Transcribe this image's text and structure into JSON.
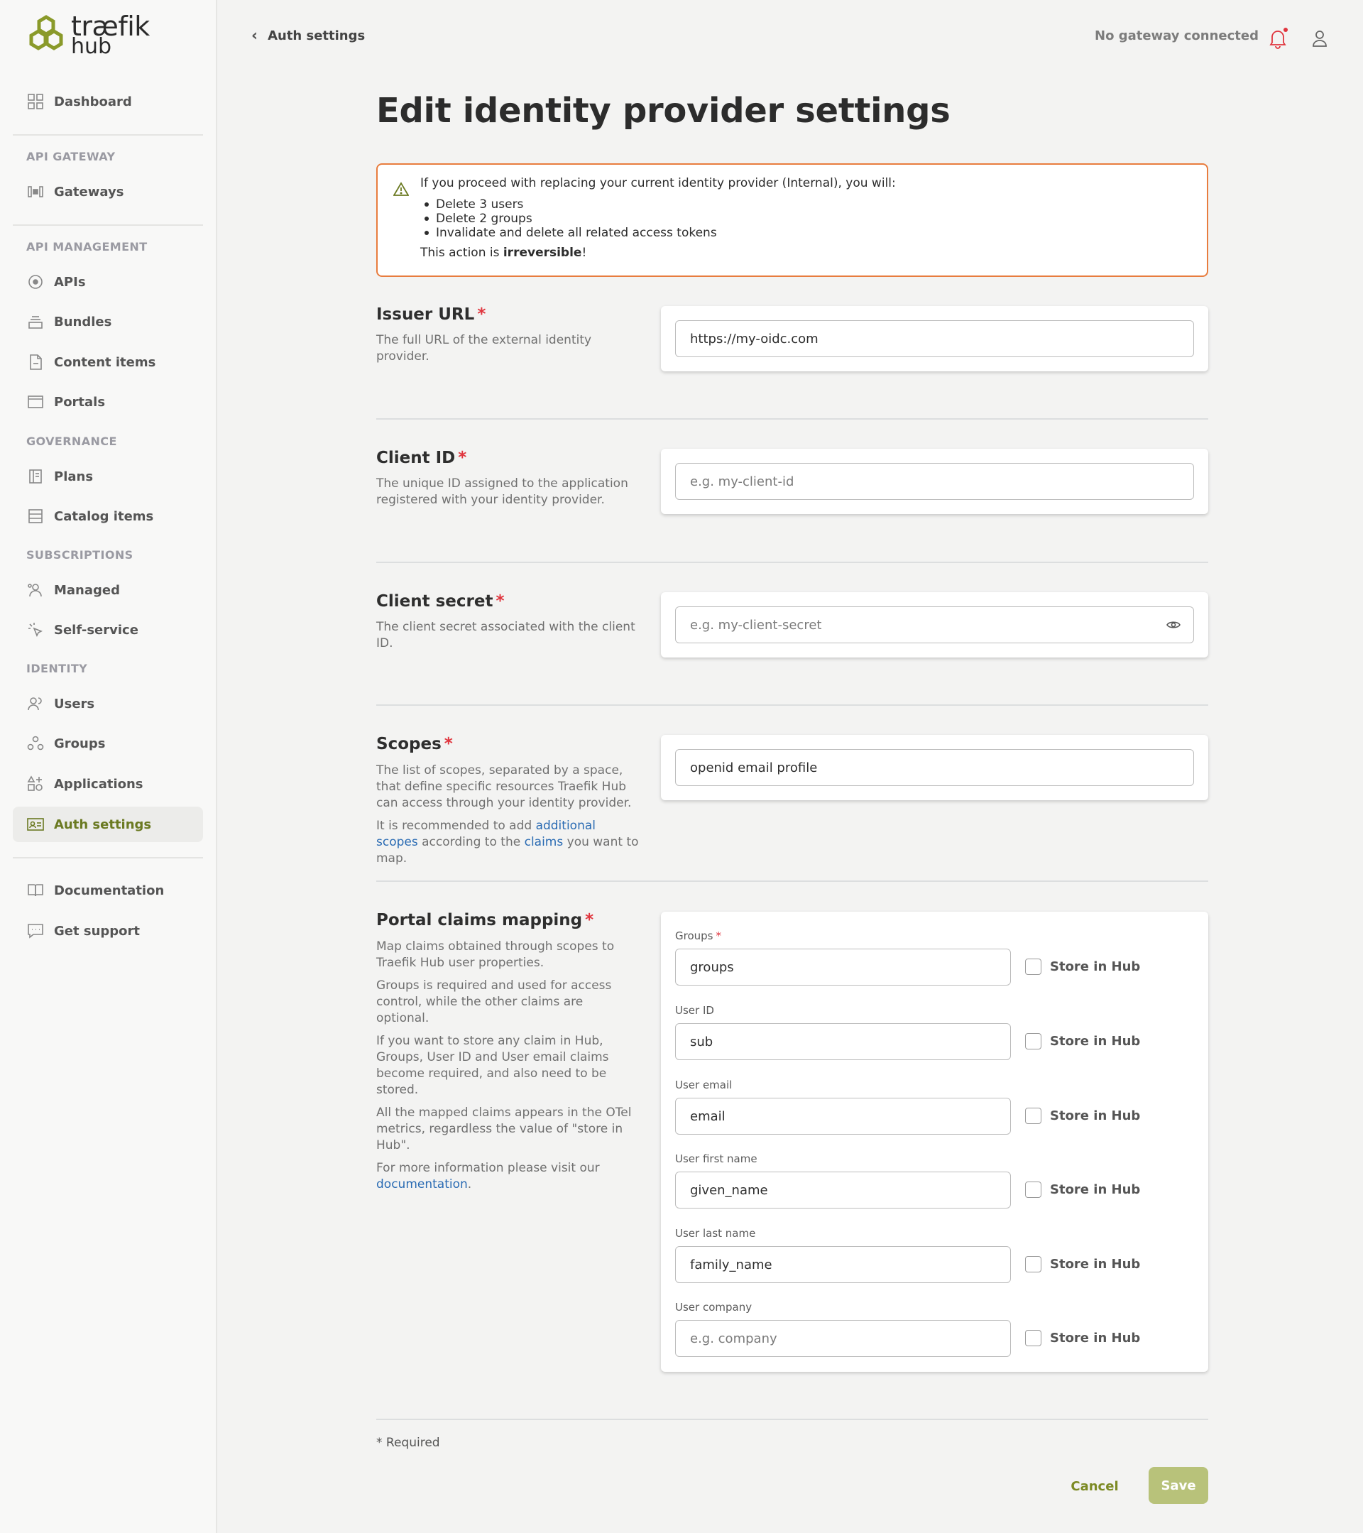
{
  "brand": {
    "name": "træfik",
    "sub": "hub",
    "accent": "#6b7a22"
  },
  "sidebar": {
    "dashboard": "Dashboard",
    "sections": {
      "api_gateway": "API GATEWAY",
      "api_management": "API MANAGEMENT",
      "governance": "GOVERNANCE",
      "subscriptions": "SUBSCRIPTIONS",
      "identity": "IDENTITY"
    },
    "items": {
      "gateways": "Gateways",
      "apis": "APIs",
      "bundles": "Bundles",
      "content_items": "Content items",
      "portals": "Portals",
      "plans": "Plans",
      "catalog_items": "Catalog items",
      "managed": "Managed",
      "self_service": "Self-service",
      "users": "Users",
      "groups": "Groups",
      "applications": "Applications",
      "auth_settings": "Auth settings",
      "documentation": "Documentation",
      "get_support": "Get support"
    }
  },
  "topbar": {
    "back_label": "Auth settings",
    "gateway_status": "No gateway connected"
  },
  "page": {
    "title": "Edit identity provider settings"
  },
  "warning": {
    "intro": "If you proceed with replacing your current identity provider (Internal), you will:",
    "bullets": [
      "Delete 3 users",
      "Delete 2 groups",
      "Invalidate and delete all related access tokens"
    ],
    "action_prefix": "This action is ",
    "action_bold": "irreversible",
    "action_suffix": "!"
  },
  "issuer_url": {
    "title": "Issuer URL",
    "required": "*",
    "desc": "The full URL of the external identity provider.",
    "value": "https://my-oidc.com"
  },
  "client_id": {
    "title": "Client ID",
    "required": "*",
    "desc": "The unique ID assigned to the application registered with your identity provider.",
    "placeholder": "e.g. my-client-id"
  },
  "client_secret": {
    "title": "Client secret",
    "required": "*",
    "desc": "The client secret associated with the client ID.",
    "placeholder": "e.g. my-client-secret"
  },
  "scopes": {
    "title": "Scopes",
    "required": "*",
    "desc": "The list of scopes, separated by a space, that define specific resources Traefik Hub can access through your identity provider.",
    "rec_prefix": "It is recommended to add ",
    "rec_link1": "additional scopes",
    "rec_mid": " according to the ",
    "rec_link2": "claims",
    "rec_suffix": " you want to map.",
    "value": "openid email profile"
  },
  "claims": {
    "title": "Portal claims mapping",
    "required": "*",
    "desc1": "Map claims obtained through scopes to Traefik Hub user properties.",
    "desc2": "Groups is required and used for access control, while the other claims are optional.",
    "desc3": "If you want to store any claim in Hub, Groups, User ID and User email claims become required, and also need to be stored.",
    "desc4": "All the mapped claims appears in the OTel metrics, regardless the value of \"store in Hub\".",
    "desc5_prefix": "For more information please visit our ",
    "desc5_link": "documentation",
    "desc5_suffix": ".",
    "store_label": "Store in Hub",
    "fields": [
      {
        "label": "Groups",
        "required": "*",
        "value": "groups"
      },
      {
        "label": "User ID",
        "value": "sub"
      },
      {
        "label": "User email",
        "value": "email"
      },
      {
        "label": "User first name",
        "value": "given_name"
      },
      {
        "label": "User last name",
        "value": "family_name"
      },
      {
        "label": "User company",
        "placeholder": "e.g. company"
      }
    ]
  },
  "footer": {
    "required_note": "* Required",
    "cancel": "Cancel",
    "save": "Save"
  }
}
